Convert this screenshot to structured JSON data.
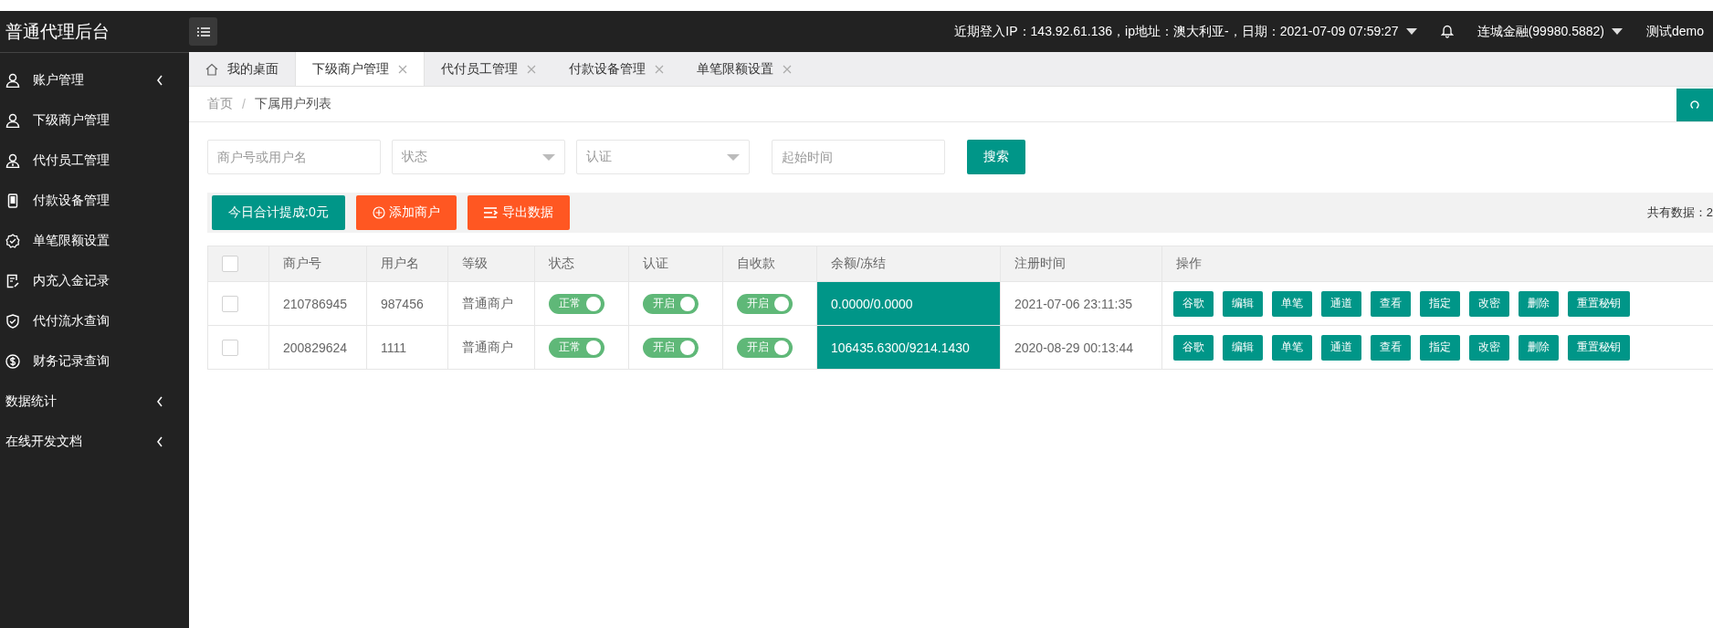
{
  "brand": "普通代理后台",
  "header": {
    "login_info": "近期登入IP：143.92.61.136，ip地址：澳大利亚-，日期：2021-07-09 07:59:27",
    "account": "连城金融(99980.5882)",
    "user": "测试demo"
  },
  "sidebar": {
    "items": [
      {
        "label": "账户管理",
        "expanded": false
      },
      {
        "label": "下级商户管理"
      },
      {
        "label": "代付员工管理"
      },
      {
        "label": "付款设备管理"
      },
      {
        "label": "单笔限额设置"
      },
      {
        "label": "内充入金记录"
      },
      {
        "label": "代付流水查询"
      },
      {
        "label": "财务记录查询"
      },
      {
        "label": "数据统计",
        "expanded": false
      },
      {
        "label": "在线开发文档",
        "expanded": false
      }
    ]
  },
  "tabs": [
    {
      "label": "我的桌面",
      "kind": "home",
      "selected": false
    },
    {
      "label": "下级商户管理",
      "kind": "closable",
      "selected": true
    },
    {
      "label": "代付员工管理",
      "kind": "closable",
      "selected": false
    },
    {
      "label": "付款设备管理",
      "kind": "closable",
      "selected": false
    },
    {
      "label": "单笔限额设置",
      "kind": "closable",
      "selected": false
    }
  ],
  "breadcrumb": {
    "separator": "/",
    "items": [
      "首页",
      "下属用户列表"
    ]
  },
  "filters": [
    {
      "kind": "text",
      "placeholder": "商户号或用户名"
    },
    {
      "kind": "select",
      "placeholder": "状态"
    },
    {
      "kind": "select",
      "placeholder": "认证"
    },
    {
      "kind": "text",
      "placeholder": "起始时间"
    }
  ],
  "search_button": "搜索",
  "toolbar": {
    "buttons": [
      {
        "label": "今日合计提成:0元",
        "kind": "info"
      },
      {
        "label": "添加商户",
        "kind": "add"
      },
      {
        "label": "导出数据",
        "kind": "export"
      }
    ],
    "total": "共有数据：2"
  },
  "table": {
    "select_all_checked": false,
    "columns": [
      "商户号",
      "用户名",
      "等级",
      "状态",
      "认证",
      "自收款",
      "余额/冻结",
      "注册时间",
      "操作"
    ],
    "rows": [
      {
        "checked": false,
        "id": "210786945",
        "username": "987456",
        "level_name": "普通商户",
        "status": {
          "label": "正常",
          "on": true
        },
        "auth": {
          "label": "开启",
          "on": true
        },
        "self_collect": {
          "label": "开启",
          "on": true
        },
        "balance": "0.0000/0.0000",
        "registered": "2021-07-06 23:11:35",
        "actions": [
          "谷歌",
          "编辑",
          "单笔",
          "通道",
          "查看",
          "指定",
          "改密",
          "删除",
          "重置秘钥"
        ]
      },
      {
        "checked": false,
        "id": "200829624",
        "username": "1111",
        "level_name": "普通商户",
        "status": {
          "label": "正常",
          "on": true
        },
        "auth": {
          "label": "开启",
          "on": true
        },
        "self_collect": {
          "label": "开启",
          "on": true
        },
        "balance": "106435.6300/9214.1430",
        "registered": "2020-08-29 00:13:44",
        "actions": [
          "谷歌",
          "编辑",
          "单笔",
          "通道",
          "查看",
          "指定",
          "改密",
          "删除",
          "重置秘钥"
        ]
      }
    ]
  }
}
